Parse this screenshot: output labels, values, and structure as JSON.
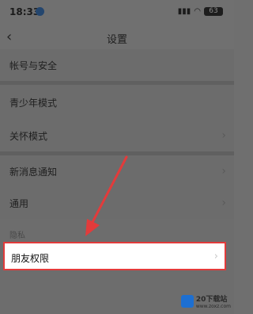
{
  "status_bar": {
    "time": "18:33",
    "right_icons": [
      "signal-icon",
      "wifi-icon",
      "battery-icon"
    ],
    "battery_level": "63"
  },
  "nav": {
    "back_icon": "‹",
    "title": "设置"
  },
  "items": [
    {
      "label": "帐号与安全"
    },
    {
      "label": "青少年模式"
    },
    {
      "label": "关怀模式"
    },
    {
      "label": "新消息通知"
    },
    {
      "label": "通用"
    }
  ],
  "chevron": "›",
  "section_label": "隐私",
  "highlight": {
    "label": "朋友权限",
    "border_color": "#e23b3b"
  },
  "arrow_color": "#e23b3b",
  "watermark": {
    "text_line1": "20下载站",
    "text_line2": "www.zoxz.com"
  }
}
